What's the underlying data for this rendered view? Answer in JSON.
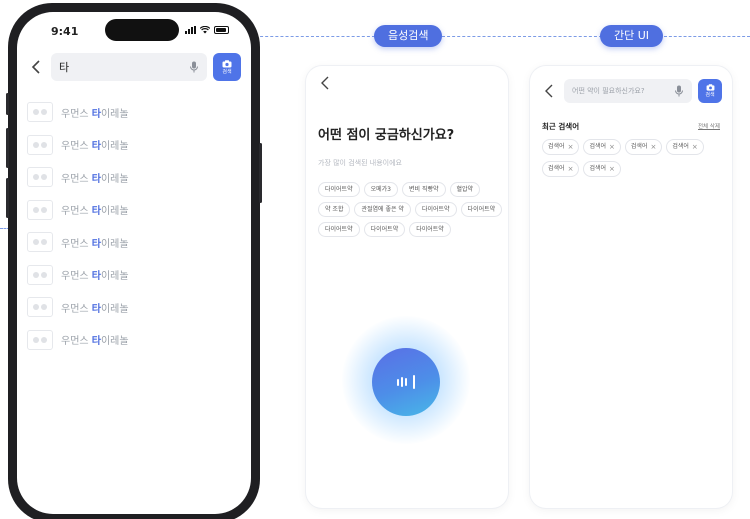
{
  "labels": {
    "voice_search": "음성검색",
    "simple_ui": "간단 UI"
  },
  "colors": {
    "accent": "#4f6fe0",
    "highlight": "#4f6fe0",
    "orb_start": "#5a6fe6",
    "orb_end": "#48b8e8"
  },
  "phone1": {
    "status_time": "9:41",
    "search_value": "타",
    "camera_label": "검색",
    "results": [
      {
        "pre": "우먼스 ",
        "hl": "타",
        "post": "이레놀"
      },
      {
        "pre": "우먼스 ",
        "hl": "타",
        "post": "이레놀"
      },
      {
        "pre": "우먼스 ",
        "hl": "타",
        "post": "이레놀"
      },
      {
        "pre": "우먼스 ",
        "hl": "타",
        "post": "이레놀"
      },
      {
        "pre": "우먼스 ",
        "hl": "타",
        "post": "이레놀"
      },
      {
        "pre": "우먼스 ",
        "hl": "타",
        "post": "이레놀"
      },
      {
        "pre": "우먼스 ",
        "hl": "타",
        "post": "이레놀"
      },
      {
        "pre": "우먼스 ",
        "hl": "타",
        "post": "이레놀"
      }
    ]
  },
  "voice": {
    "question": "어떤 점이 궁금하신가요?",
    "hint": "가장 많이 검색된 내용이에요",
    "tags": [
      "다이어트약",
      "오메가3",
      "변비 직빵약",
      "혈압약",
      "약 조합",
      "관절염에 좋은 약",
      "다이어트약",
      "다이어트약",
      "다이어트약",
      "다이어트약",
      "다이어트약"
    ]
  },
  "simple": {
    "placeholder": "어떤 약이 필요하신가요?",
    "camera_label": "검색",
    "recent_title": "최근 검색어",
    "delete_all": "전체 삭제",
    "chips": [
      "검색어",
      "검색어",
      "검색어",
      "검색어",
      "검색어",
      "검색어"
    ]
  }
}
